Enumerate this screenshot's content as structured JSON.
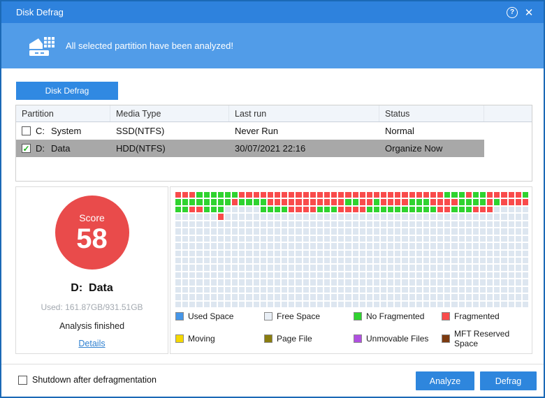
{
  "window": {
    "title": "Disk Defrag"
  },
  "titlebar": {
    "help_icon": "?",
    "close_icon": "✕"
  },
  "banner": {
    "message": "All selected partition have been analyzed!"
  },
  "tab": {
    "label": "Disk Defrag"
  },
  "partition_table": {
    "columns": [
      "Partition",
      "Media Type",
      "Last run",
      "Status"
    ],
    "rows": [
      {
        "checked": false,
        "selected": false,
        "drive": "C:",
        "name": "System",
        "media_type": "SSD(NTFS)",
        "last_run": "Never Run",
        "status": "Normal"
      },
      {
        "checked": true,
        "selected": true,
        "drive": "D:",
        "name": "Data",
        "media_type": "HDD(NTFS)",
        "last_run": "30/07/2021 22:16",
        "status": "Organize Now"
      }
    ]
  },
  "summary": {
    "score_label": "Score",
    "score_value": "58",
    "drive": "D:",
    "name": "Data",
    "used": "Used: 161.87GB/931.51GB",
    "status": "Analysis finished",
    "details_link": "Details"
  },
  "map": {
    "columns": 50,
    "cell_colors": {
      "R": "#f94b4b",
      "G": "#2fd32f",
      "E": "#dde6f0"
    },
    "rows": [
      "RRRGGGGGGRRRRRRRRRRRRRRRRRRRRRRRRRRRRRGGGRGGRRRRRG",
      "GGGGGGGGRGGGGRRRRRRRRRRRGGRRGRRRRGGGRRRRGGGGRGRRRR",
      "GGRRGGGEEEEEGGGGRRRRGGGRRRRGGGGGGGGGGRRGGGRRREEEEE",
      "EEEEEEREEEEEEEEEEEEEEEEEEEEEEEEEEEEEEEEEEEEEEEEEEE",
      "EEEEEEEEEEEEEEEEEEEEEEEEEEEEEEEEEEEEEEEEEEEEEEEEEE",
      "EEEEEEEEEEEEEEEEEEEEEEEEEEEEEEEEEEEEEEEEEEEEEEEEEE",
      "EEEEEEEEEEEEEEEEEEEEEEEEEEEEEEEEEEEEEEEEEEEEEEEEEE",
      "EEEEEEEEEEEEEEEEEEEEEEEEEEEEEEEEEEEEEEEEEEEEEEEEEE",
      "EEEEEEEEEEEEEEEEEEEEEEEEEEEEEEEEEEEEEEEEEEEEEEEEEE",
      "EEEEEEEEEEEEEEEEEEEEEEEEEEEEEEEEEEEEEEEEEEEEEEEEEE",
      "EEEEEEEEEEEEEEEEEEEEEEEEEEEEEEEEEEEEEEEEEEEEEEEEEE",
      "EEEEEEEEEEEEEEEEEEEEEEEEEEEEEEEEEEEEEEEEEEEEEEEEEE",
      "EEEEEEEEEEEEEEEEEEEEEEEEEEEEEEEEEEEEEEEEEEEEEEEEEE",
      "EEEEEEEEEEEEEEEEEEEEEEEEEEEEEEEEEEEEEEEEEEEEEEEEEE",
      "EEEEEEEEEEEEEEEEEEEEEEEEEEEEEEEEEEEEEEEEEEEEEEEEEE",
      "EEEEEEEEEEEEEEEEEEEEEEEEEEEEEEEEEEEEEEEEEEEEEEEEEE"
    ]
  },
  "legend": [
    {
      "label": "Used Space",
      "color": "#4596e8"
    },
    {
      "label": "Free Space",
      "color": "#e9eff6"
    },
    {
      "label": "No Fragmented",
      "color": "#2fd32f"
    },
    {
      "label": "Fragmented",
      "color": "#f94b4b"
    },
    {
      "label": "Moving",
      "color": "#f5d800"
    },
    {
      "label": "Page File",
      "color": "#8a7d0f"
    },
    {
      "label": "Unmovable Files",
      "color": "#b050e0"
    },
    {
      "label": "MFT Reserved Space",
      "color": "#7c3a10"
    }
  ],
  "footer": {
    "checkbox_label": "Shutdown after defragmentation",
    "checkbox_checked": false,
    "analyze_button": "Analyze",
    "defrag_button": "Defrag"
  },
  "colors": {
    "titlebar": "#2e82dd",
    "banner": "#519ce8",
    "accent_button": "#2e86dd",
    "selected_row": "#a8a8a8",
    "score_circle": "#e94b4b",
    "checkmark_green": "#1db31d"
  }
}
